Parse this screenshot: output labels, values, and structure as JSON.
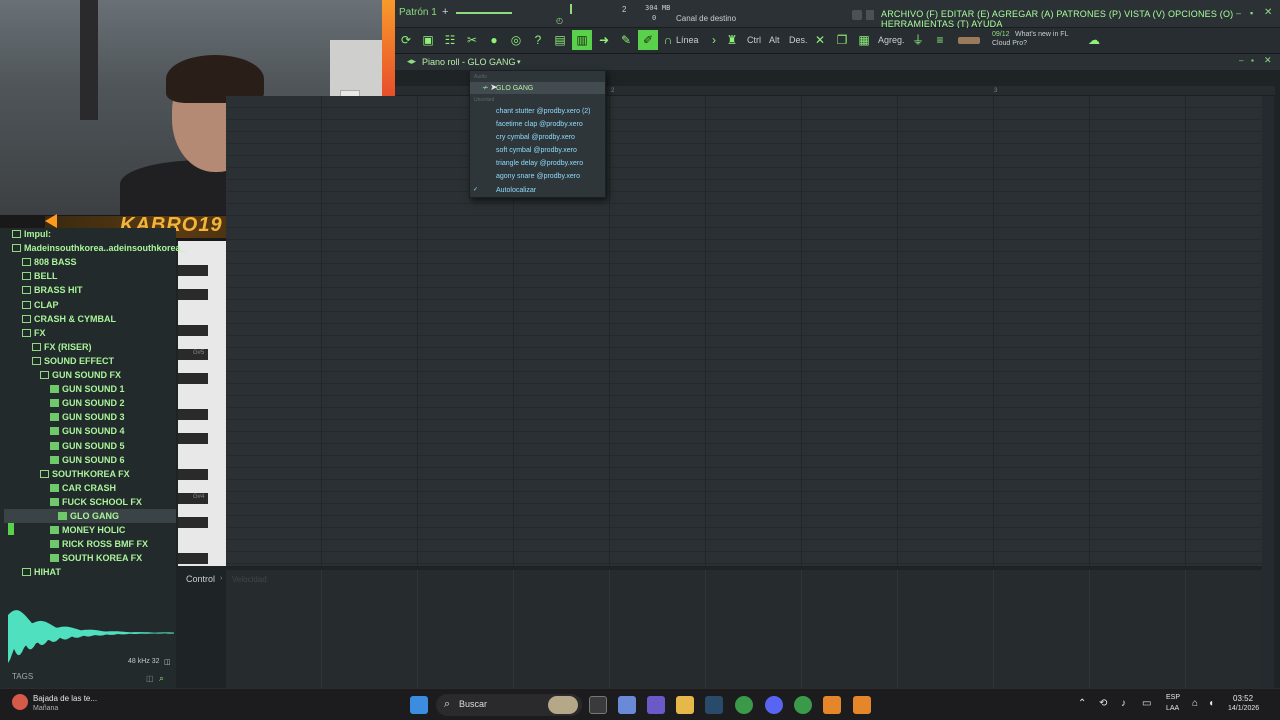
{
  "app": {
    "pattern_label": "Patrón 1",
    "pattern_plus": "+",
    "tempo_top": "2",
    "memory": "304 MB",
    "memory_sub": "0",
    "dest_channel": "Canal de destino",
    "menu": "ARCHIVO (F) EDITAR (E) AGREGAR (A) PATRONES (P) VISTA (V) OPCIONES (O) HERRAMIENTAS (T) AYUDA",
    "news_date": "09/12",
    "news_title": "What's new in FL",
    "news_sub": "Cloud Pro?"
  },
  "toolbar": {
    "line_mode": "Línea",
    "ctrl": "Ctrl",
    "alt": "Alt",
    "des": "Des.",
    "agreg": "Agreg."
  },
  "overlay": {
    "streamer_name": "KABRO19"
  },
  "piano_roll": {
    "title": "Piano roll - GLO GANG",
    "ruler_marks": [
      "2",
      "3"
    ],
    "key_labels": [
      "G#5",
      "G#4"
    ],
    "control_label": "Control",
    "control_target": "Velocidad"
  },
  "dropdown": {
    "caption_audio": "Audio",
    "selected": "GLO GANG",
    "caption_unsorted": "Unsorted",
    "items": [
      "chant stutter @prodby.xero (2)",
      "facetime clap @prodby.xero",
      "cry cymbal @prodby.xero",
      "soft cymbal @prodby.xero",
      "triangle delay @prodby.xero",
      "agony snare @prodby.xero"
    ],
    "autolocalize": "Autolocalizar",
    "check": "✓"
  },
  "browser": {
    "items": [
      {
        "label": "Impul:",
        "level": 0,
        "type": "folder"
      },
      {
        "label": "Madeinsouthkorea..adeinsouthkorea_",
        "level": 0,
        "type": "folder"
      },
      {
        "label": "808 BASS",
        "level": 1,
        "type": "folder"
      },
      {
        "label": "BELL",
        "level": 1,
        "type": "folder"
      },
      {
        "label": "BRASS HIT",
        "level": 1,
        "type": "folder"
      },
      {
        "label": "CLAP",
        "level": 1,
        "type": "folder"
      },
      {
        "label": "CRASH & CYMBAL",
        "level": 1,
        "type": "folder"
      },
      {
        "label": "FX",
        "level": 1,
        "type": "folder"
      },
      {
        "label": "FX (RISER)",
        "level": 2,
        "type": "folder"
      },
      {
        "label": "SOUND EFFECT",
        "level": 2,
        "type": "folder"
      },
      {
        "label": "GUN SOUND FX",
        "level": 3,
        "type": "folder"
      },
      {
        "label": "GUN SOUND 1",
        "level": 4,
        "type": "file"
      },
      {
        "label": "GUN SOUND 2",
        "level": 4,
        "type": "file"
      },
      {
        "label": "GUN SOUND 3",
        "level": 4,
        "type": "file"
      },
      {
        "label": "GUN SOUND 4",
        "level": 4,
        "type": "file"
      },
      {
        "label": "GUN SOUND 5",
        "level": 4,
        "type": "file"
      },
      {
        "label": "GUN SOUND 6",
        "level": 4,
        "type": "file"
      },
      {
        "label": "SOUTHKOREA FX",
        "level": 3,
        "type": "folder"
      },
      {
        "label": "CAR CRASH",
        "level": 4,
        "type": "file"
      },
      {
        "label": "FUCK SCHOOL FX",
        "level": 4,
        "type": "file"
      },
      {
        "label": "GLO GANG",
        "level": 5,
        "type": "file",
        "selected": true
      },
      {
        "label": "MONEY HOLIC",
        "level": 4,
        "type": "file"
      },
      {
        "label": "RICK ROSS BMF FX",
        "level": 4,
        "type": "file"
      },
      {
        "label": "SOUTH KOREA FX",
        "level": 4,
        "type": "file"
      },
      {
        "label": "HIHAT",
        "level": 1,
        "type": "folder"
      }
    ],
    "wave_info": "48 kHz 32",
    "tags_label": "TAGS"
  },
  "taskbar": {
    "notif_title": "Bajada de las te...",
    "notif_sub": "Mañana",
    "search_placeholder": "Buscar",
    "lang": "ESP",
    "lang_sub": "LAA",
    "time": "03:52",
    "date": "14/1/2026"
  },
  "colors": {
    "accent": "#a8ff9c",
    "highlight": "#5ad14a",
    "link": "#8fdcff",
    "overlay": "#f2b43a"
  }
}
